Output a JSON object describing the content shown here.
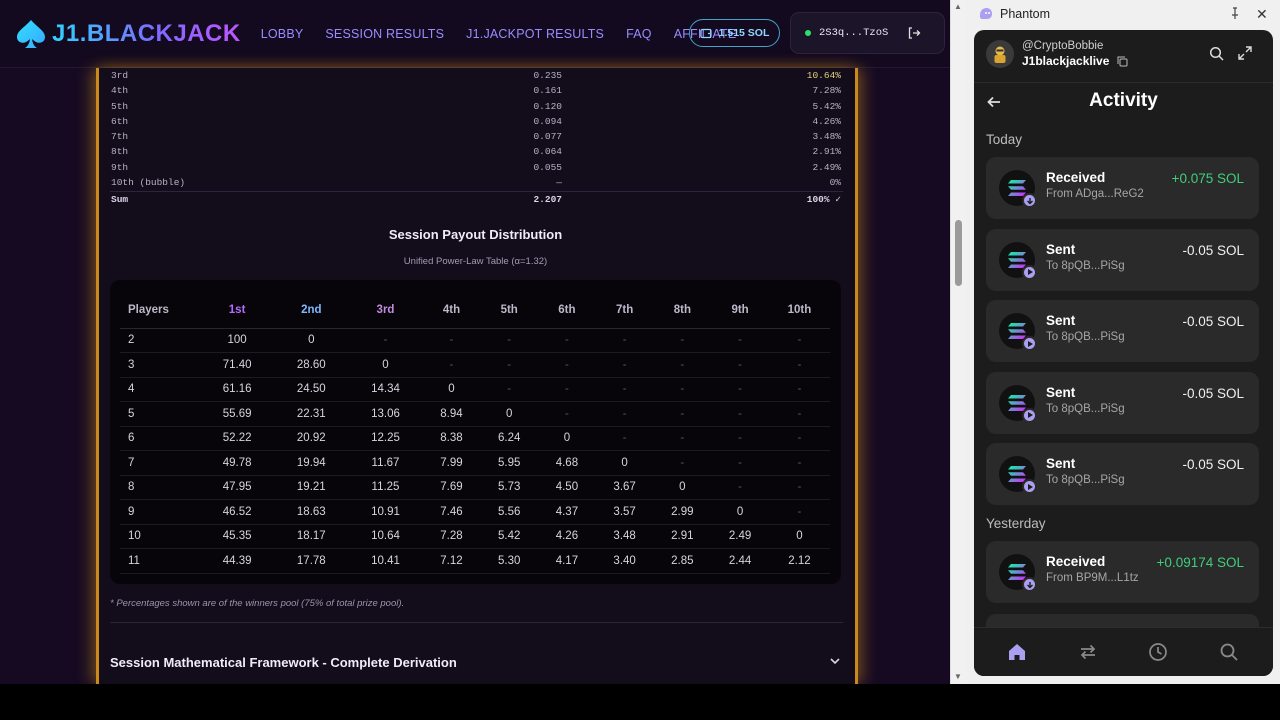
{
  "app": {
    "logo_text": "J1.BLACKJACK",
    "nav": [
      "LOBBY",
      "SESSION RESULTS",
      "J1.JACKPOT RESULTS",
      "FAQ",
      "AFFILIATE"
    ],
    "balance": "1.515 SOL",
    "wallet_address": "2S3q...TzoS"
  },
  "rank_table": {
    "rows": [
      {
        "place": "3rd",
        "weight": "0.235",
        "pct": "10.64%",
        "highlight": true
      },
      {
        "place": "4th",
        "weight": "0.161",
        "pct": "7.28%",
        "highlight": false
      },
      {
        "place": "5th",
        "weight": "0.120",
        "pct": "5.42%",
        "highlight": false
      },
      {
        "place": "6th",
        "weight": "0.094",
        "pct": "4.26%",
        "highlight": false
      },
      {
        "place": "7th",
        "weight": "0.077",
        "pct": "3.48%",
        "highlight": false
      },
      {
        "place": "8th",
        "weight": "0.064",
        "pct": "2.91%",
        "highlight": false
      },
      {
        "place": "9th",
        "weight": "0.055",
        "pct": "2.49%",
        "highlight": false
      },
      {
        "place": "10th (bubble)",
        "weight": "—",
        "pct": "0%",
        "highlight": false
      }
    ],
    "sum": {
      "place": "Sum",
      "weight": "2.207",
      "pct": "100% ✓"
    }
  },
  "distribution": {
    "title": "Session Payout Distribution",
    "subtitle": "Unified Power-Law Table (α=1.32)",
    "headers": [
      "Players",
      "1st",
      "2nd",
      "3rd",
      "4th",
      "5th",
      "6th",
      "7th",
      "8th",
      "9th",
      "10th"
    ],
    "rows": [
      [
        "2",
        "100",
        "0",
        "-",
        "-",
        "-",
        "-",
        "-",
        "-",
        "-",
        "-"
      ],
      [
        "3",
        "71.40",
        "28.60",
        "0",
        "-",
        "-",
        "-",
        "-",
        "-",
        "-",
        "-"
      ],
      [
        "4",
        "61.16",
        "24.50",
        "14.34",
        "0",
        "-",
        "-",
        "-",
        "-",
        "-",
        "-"
      ],
      [
        "5",
        "55.69",
        "22.31",
        "13.06",
        "8.94",
        "0",
        "-",
        "-",
        "-",
        "-",
        "-"
      ],
      [
        "6",
        "52.22",
        "20.92",
        "12.25",
        "8.38",
        "6.24",
        "0",
        "-",
        "-",
        "-",
        "-"
      ],
      [
        "7",
        "49.78",
        "19.94",
        "11.67",
        "7.99",
        "5.95",
        "4.68",
        "0",
        "-",
        "-",
        "-"
      ],
      [
        "8",
        "47.95",
        "19.21",
        "11.25",
        "7.69",
        "5.73",
        "4.50",
        "3.67",
        "0",
        "-",
        "-"
      ],
      [
        "9",
        "46.52",
        "18.63",
        "10.91",
        "7.46",
        "5.56",
        "4.37",
        "3.57",
        "2.99",
        "0",
        "-"
      ],
      [
        "10",
        "45.35",
        "18.17",
        "10.64",
        "7.28",
        "5.42",
        "4.26",
        "3.48",
        "2.91",
        "2.49",
        "0"
      ],
      [
        "11",
        "44.39",
        "17.78",
        "10.41",
        "7.12",
        "5.30",
        "4.17",
        "3.40",
        "2.85",
        "2.44",
        "2.12"
      ]
    ],
    "note": "* Percentages shown are of the winners pool (75% of total prize pool).",
    "framework_title": "Session Mathematical Framework - Complete Derivation"
  },
  "phantom": {
    "window_title": "Phantom",
    "handle": "@CryptoBobbie",
    "account": "J1blackjacklive",
    "page_title": "Activity",
    "sections": [
      {
        "label": "Today",
        "items": [
          {
            "type": "received",
            "label": "Received",
            "sub": "From ADga...ReG2",
            "amount": "+0.075 SOL"
          },
          {
            "type": "sent",
            "label": "Sent",
            "sub": "To 8pQB...PiSg",
            "amount": "-0.05 SOL"
          },
          {
            "type": "sent",
            "label": "Sent",
            "sub": "To 8pQB...PiSg",
            "amount": "-0.05 SOL"
          },
          {
            "type": "sent",
            "label": "Sent",
            "sub": "To 8pQB...PiSg",
            "amount": "-0.05 SOL"
          },
          {
            "type": "sent",
            "label": "Sent",
            "sub": "To 8pQB...PiSg",
            "amount": "-0.05 SOL"
          }
        ]
      },
      {
        "label": "Yesterday",
        "items": [
          {
            "type": "received",
            "label": "Received",
            "sub": "From BP9M...L1tz",
            "amount": "+0.09174 SOL"
          }
        ]
      }
    ],
    "nav_icons": [
      "home-icon",
      "swap-icon",
      "history-icon",
      "search-icon"
    ]
  },
  "colors": {
    "accent_gold": "#c98a1a",
    "phantom_purple": "#ab9ff2",
    "positive_green": "#3fcf7a"
  }
}
